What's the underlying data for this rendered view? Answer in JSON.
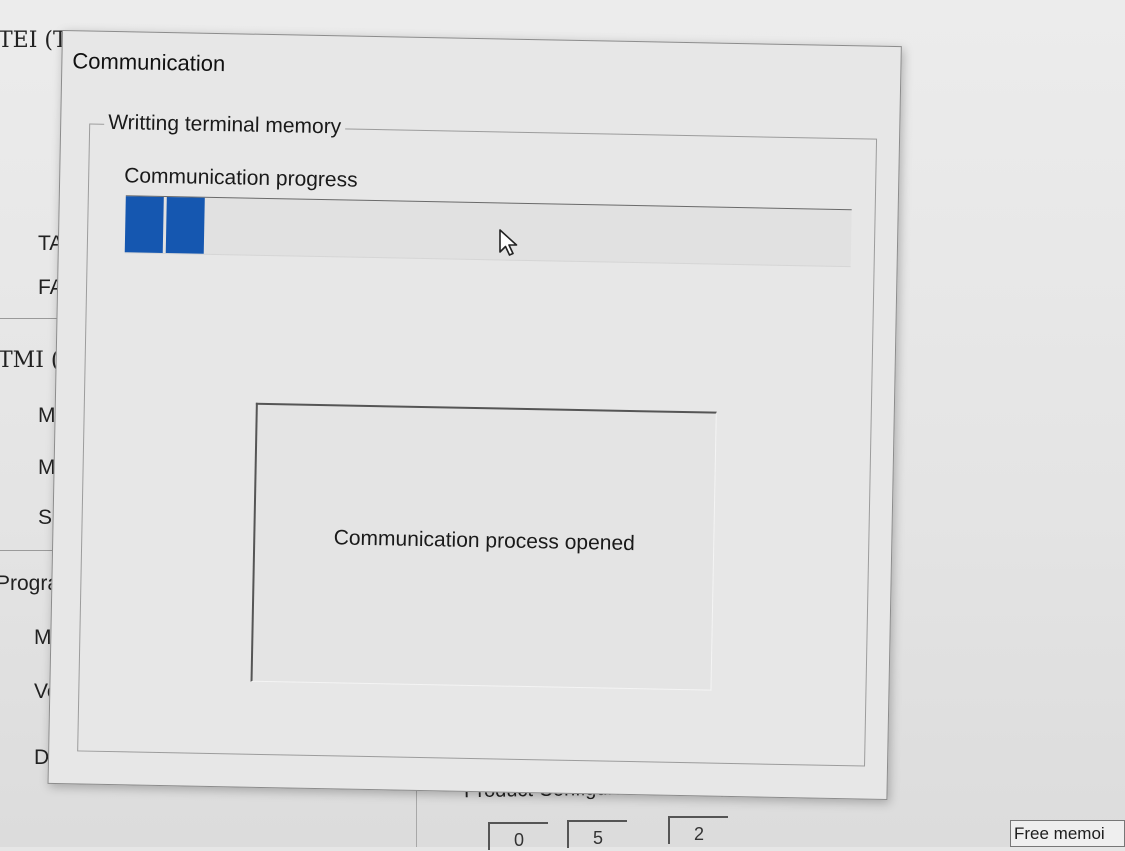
{
  "background_window": {
    "header_fragment": "TEI (T",
    "labels": [
      "TA",
      "FA"
    ],
    "section_fragment": "TMI (",
    "section_labels": [
      "MC",
      "MN",
      "SM"
    ],
    "program_fragment": "Progra",
    "program_labels": [
      "Mo",
      "Ver",
      "Dat"
    ],
    "product_configuration_label": "Product Configuration Code (",
    "config_boxes": [
      "0",
      "5",
      "2"
    ],
    "free_memory_label": "Free memoi"
  },
  "dialog": {
    "title": "Communication",
    "group_title": "Writting terminal memory",
    "progress": {
      "label": "Communication progress",
      "value_fraction": 0.11,
      "blocks": 2,
      "color": "#1557b0"
    },
    "status_message": "Communication process opened"
  },
  "cursor": {
    "icon": "arrow-pointer-icon"
  }
}
